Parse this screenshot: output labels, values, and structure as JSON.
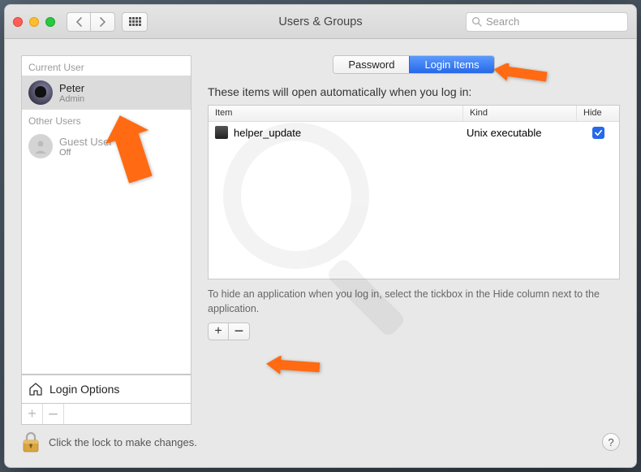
{
  "window": {
    "title": "Users & Groups"
  },
  "search": {
    "placeholder": "Search"
  },
  "sidebar": {
    "current_label": "Current User",
    "other_label": "Other Users",
    "current": {
      "name": "Peter",
      "role": "Admin"
    },
    "guest": {
      "name": "Guest User",
      "role": "Off"
    },
    "login_options": "Login Options"
  },
  "tabs": {
    "password": "Password",
    "login_items": "Login Items"
  },
  "main": {
    "heading": "These items will open automatically when you log in:",
    "col_item": "Item",
    "col_kind": "Kind",
    "col_hide": "Hide",
    "hint": "To hide an application when you log in, select the tickbox in the Hide column next to the application."
  },
  "items": [
    {
      "name": "helper_update",
      "kind": "Unix executable",
      "hide": true
    }
  ],
  "lock": {
    "text": "Click the lock to make changes."
  }
}
